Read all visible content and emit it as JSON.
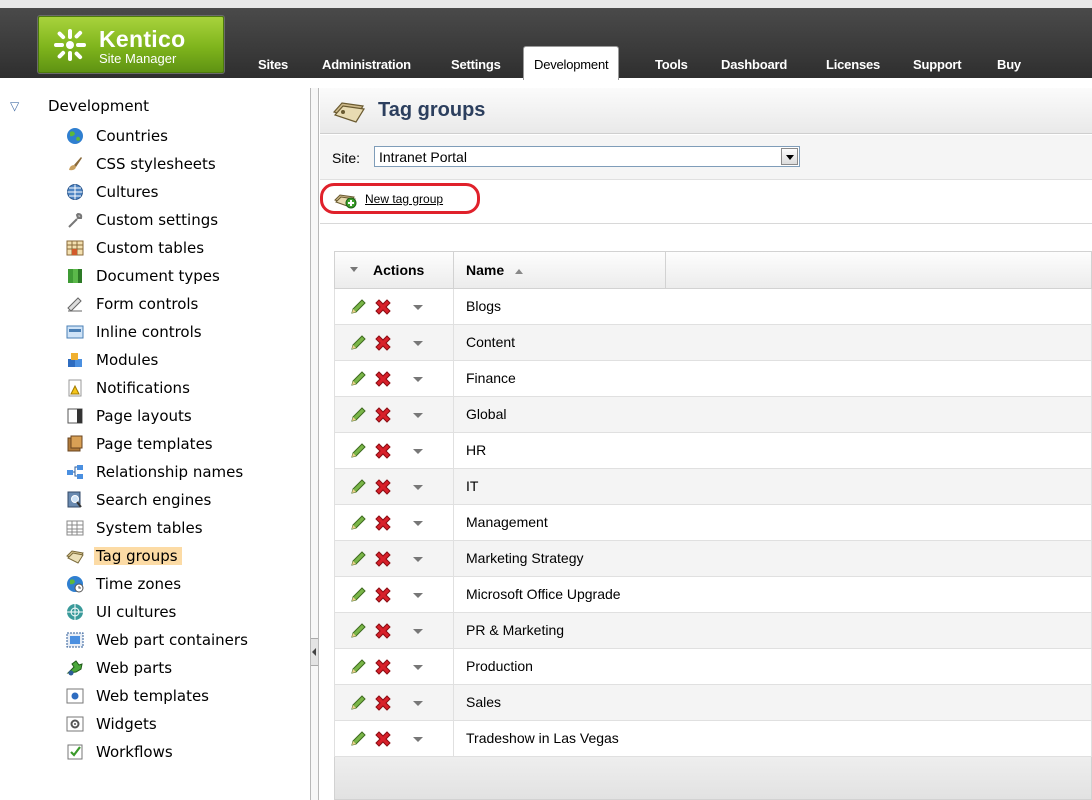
{
  "header": {
    "logo_name": "Kentico",
    "logo_subtitle": "Site Manager",
    "tabs": [
      {
        "label": "Sites"
      },
      {
        "label": "Administration"
      },
      {
        "label": "Settings"
      },
      {
        "label": "Development",
        "active": true
      },
      {
        "label": "Tools"
      },
      {
        "label": "Dashboard"
      },
      {
        "label": "Licenses"
      },
      {
        "label": "Support"
      },
      {
        "label": "Buy"
      }
    ]
  },
  "sidebar": {
    "root_label": "Development",
    "items": [
      {
        "label": "Countries",
        "icon": "globe-icon"
      },
      {
        "label": "CSS stylesheets",
        "icon": "brush-icon"
      },
      {
        "label": "Cultures",
        "icon": "globe-outline-icon"
      },
      {
        "label": "Custom settings",
        "icon": "wrench-icon"
      },
      {
        "label": "Custom tables",
        "icon": "table-icon"
      },
      {
        "label": "Document types",
        "icon": "document-type-icon"
      },
      {
        "label": "Form controls",
        "icon": "form-control-icon"
      },
      {
        "label": "Inline controls",
        "icon": "inline-control-icon"
      },
      {
        "label": "Modules",
        "icon": "modules-icon"
      },
      {
        "label": "Notifications",
        "icon": "notification-icon"
      },
      {
        "label": "Page layouts",
        "icon": "page-layout-icon"
      },
      {
        "label": "Page templates",
        "icon": "page-template-icon"
      },
      {
        "label": "Relationship names",
        "icon": "relationship-icon"
      },
      {
        "label": "Search engines",
        "icon": "search-engine-icon"
      },
      {
        "label": "System tables",
        "icon": "system-table-icon"
      },
      {
        "label": "Tag groups",
        "icon": "tag-group-icon",
        "selected": true
      },
      {
        "label": "Time zones",
        "icon": "time-zone-icon"
      },
      {
        "label": "UI cultures",
        "icon": "ui-culture-icon"
      },
      {
        "label": "Web part containers",
        "icon": "web-part-container-icon"
      },
      {
        "label": "Web parts",
        "icon": "web-part-icon"
      },
      {
        "label": "Web templates",
        "icon": "web-template-icon"
      },
      {
        "label": "Widgets",
        "icon": "widget-icon"
      },
      {
        "label": "Workflows",
        "icon": "workflow-icon"
      }
    ]
  },
  "main": {
    "title": "Tag groups",
    "site_label": "Site:",
    "site_value": "Intranet Portal",
    "new_button_label": "New tag group",
    "grid": {
      "col_actions": "Actions",
      "col_name": "Name",
      "sort": "ascending",
      "rows": [
        {
          "name": "Blogs"
        },
        {
          "name": "Content"
        },
        {
          "name": "Finance"
        },
        {
          "name": "Global"
        },
        {
          "name": "HR"
        },
        {
          "name": "IT"
        },
        {
          "name": "Management"
        },
        {
          "name": "Marketing Strategy"
        },
        {
          "name": "Microsoft Office Upgrade"
        },
        {
          "name": "PR & Marketing"
        },
        {
          "name": "Production"
        },
        {
          "name": "Sales"
        },
        {
          "name": "Tradeshow in Las Vegas"
        }
      ]
    }
  },
  "colors": {
    "selected_highlight": "#fcdba5",
    "callout_red": "#e0212b",
    "logo_green": "#7fb41c",
    "title_blue": "#2c3f5e"
  }
}
